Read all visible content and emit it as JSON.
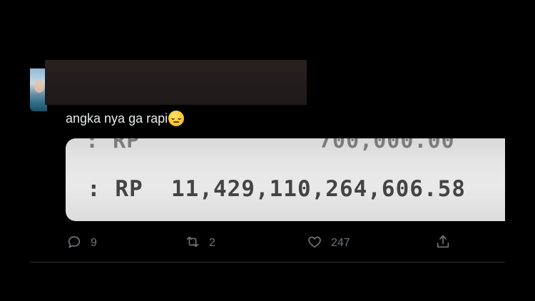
{
  "tweet": {
    "text": "angka nya ga rapi",
    "emoji": "pensive-face-emoji"
  },
  "media": {
    "top_left_fragment": ": RP",
    "top_right_fragment": "700,000.00",
    "main_line": ": RP  11,429,110,264,606.58"
  },
  "actions": {
    "reply_count": "9",
    "retweet_count": "2",
    "like_count": "247"
  },
  "colors": {
    "background": "#000000",
    "text": "#e7e9ea",
    "muted": "#71767b",
    "divider": "#2f3336"
  }
}
